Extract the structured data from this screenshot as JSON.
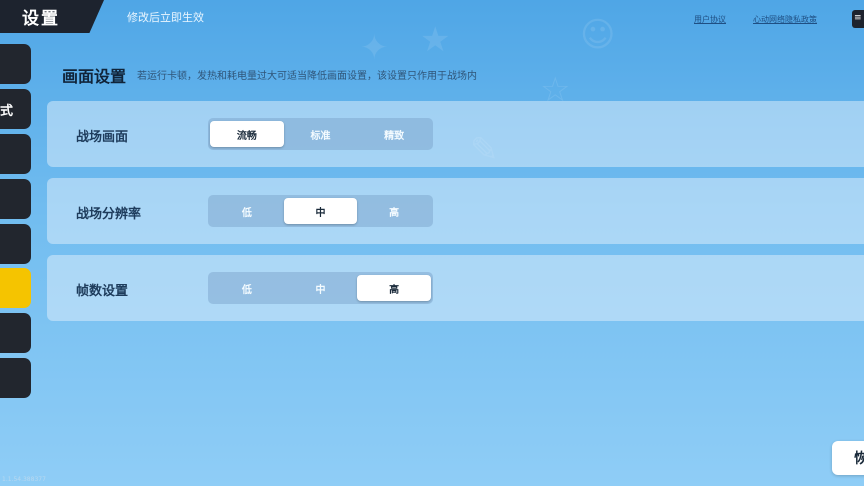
{
  "header": {
    "title": "设置",
    "subtitle": "修改后立即生效",
    "links": [
      "用户协议",
      "心动网络隐私政策"
    ],
    "corner_label": "≡"
  },
  "sidebar": {
    "items": [
      {
        "label": "",
        "active": false
      },
      {
        "label": "式",
        "active": false
      },
      {
        "label": "",
        "active": false
      },
      {
        "label": "",
        "active": false
      },
      {
        "label": "",
        "active": false
      },
      {
        "label": "",
        "active": true
      },
      {
        "label": "",
        "active": false
      },
      {
        "label": "",
        "active": false
      }
    ]
  },
  "section": {
    "title": "画面设置",
    "description": "若运行卡顿，发热和耗电量过大可适当降低画面设置，该设置只作用于战场内"
  },
  "settings": [
    {
      "label": "战场画面",
      "options": [
        "流畅",
        "标准",
        "精致"
      ],
      "selected": "流畅"
    },
    {
      "label": "战场分辨率",
      "options": [
        "低",
        "中",
        "高"
      ],
      "selected": "中"
    },
    {
      "label": "帧数设置",
      "options": [
        "低",
        "中",
        "高"
      ],
      "selected": "高"
    }
  ],
  "footer": {
    "version": "1.1.54.388377",
    "reset_label": "恢"
  },
  "colors": {
    "accent": "#f5c400",
    "sidebar": "#22262e",
    "background": "#5fb0ea"
  }
}
